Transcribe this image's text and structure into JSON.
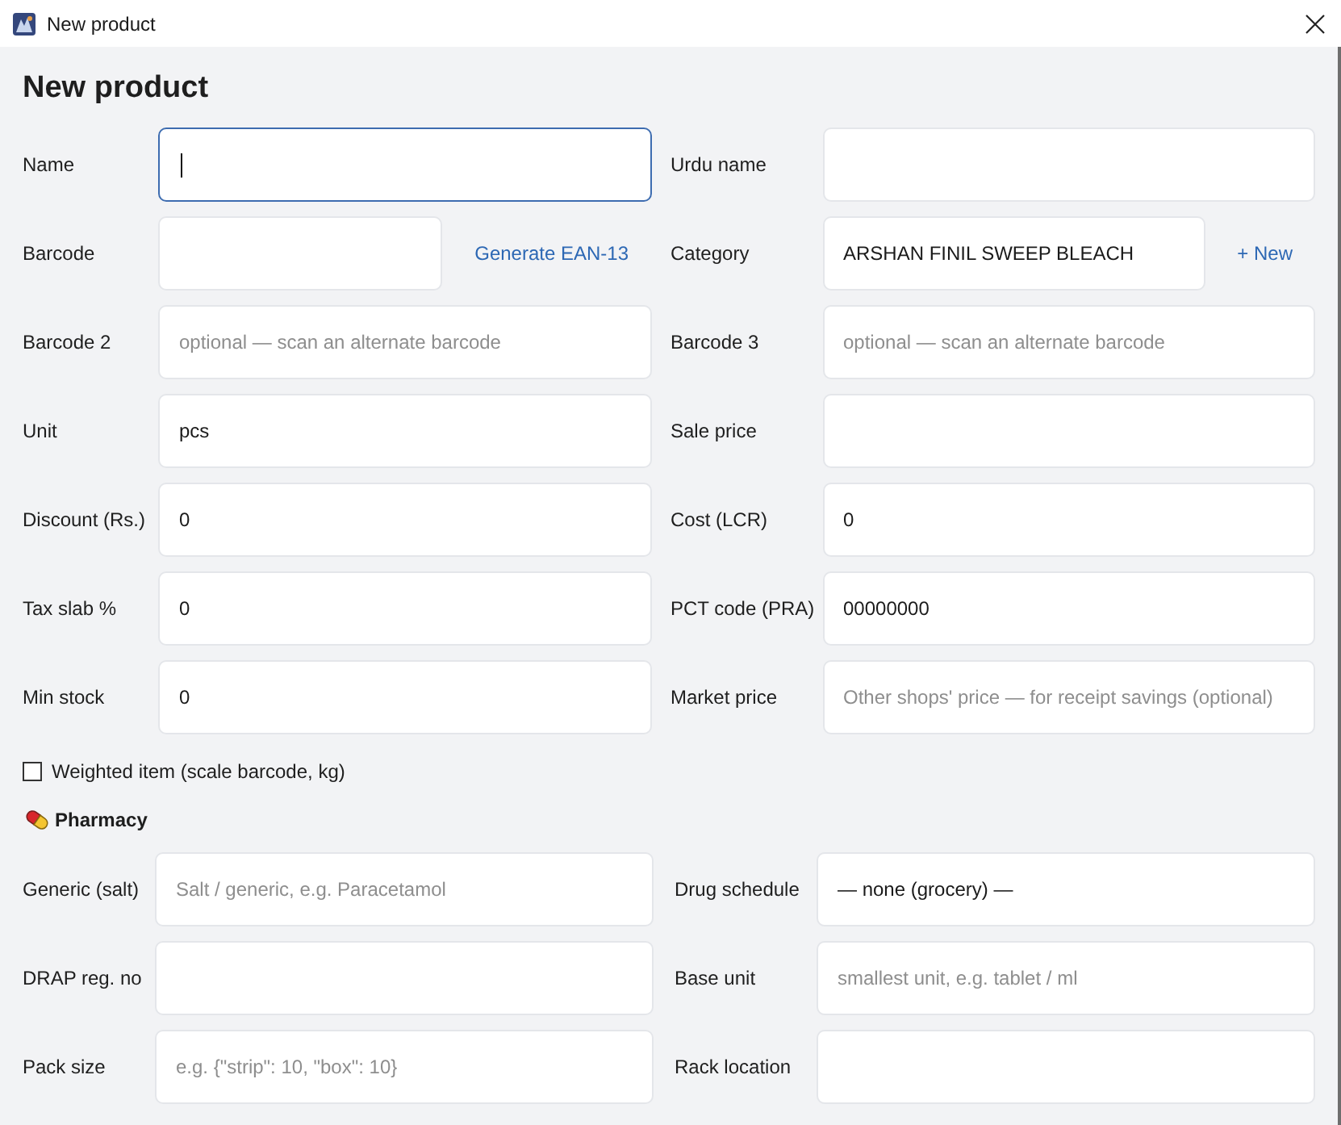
{
  "window": {
    "title": "New product"
  },
  "heading": "New product",
  "rows": [
    {
      "left": {
        "label": "Name",
        "focused": true
      },
      "right": {
        "label": "Urdu name",
        "focused": false
      }
    },
    {
      "left": {
        "label": "Barcode",
        "action": "Generate EAN-13",
        "focused": false
      },
      "right": {
        "label": "Category",
        "value": "ARSHAN FINIL SWEEP BLEACH",
        "action": "+ New",
        "focused": false
      }
    },
    {
      "left": {
        "label": "Barcode 2",
        "placeholder": "optional — scan an alternate barcode",
        "focused": false
      },
      "right": {
        "label": "Barcode 3",
        "placeholder": "optional — scan an alternate barcode",
        "focused": false
      }
    },
    {
      "left": {
        "label": "Unit",
        "value": "pcs",
        "focused": false
      },
      "right": {
        "label": "Sale price",
        "focused": false
      }
    },
    {
      "left": {
        "label": "Discount (Rs.)",
        "value": "0",
        "focused": false
      },
      "right": {
        "label": "Cost (LCR)",
        "value": "0",
        "focused": false
      }
    },
    {
      "left": {
        "label": "Tax slab %",
        "value": "0",
        "focused": false
      },
      "right": {
        "label": "PCT code (PRA)",
        "value": "00000000",
        "focused": false
      }
    },
    {
      "left": {
        "label": "Min stock",
        "value": "0",
        "focused": false
      },
      "right": {
        "label": "Market price",
        "placeholder": "Other shops' price — for receipt savings (optional)",
        "focused": false
      }
    }
  ],
  "weighted": {
    "label": "Weighted item (scale barcode, kg)",
    "checked": false
  },
  "pharmacy": {
    "title": "Pharmacy",
    "rows": [
      {
        "left": {
          "label": "Generic (salt)",
          "placeholder": "Salt / generic, e.g. Paracetamol",
          "focused": false
        },
        "right": {
          "label": "Drug schedule",
          "value": "— none (grocery) —",
          "focused": false
        }
      },
      {
        "left": {
          "label": "DRAP reg. no",
          "focused": false
        },
        "right": {
          "label": "Base unit",
          "placeholder": "smallest unit, e.g. tablet / ml",
          "focused": false
        }
      },
      {
        "left": {
          "label": "Pack size",
          "placeholder": "e.g. {\"strip\": 10, \"box\": 10}",
          "focused": false
        },
        "right": {
          "label": "Rack location",
          "focused": false
        }
      }
    ]
  }
}
